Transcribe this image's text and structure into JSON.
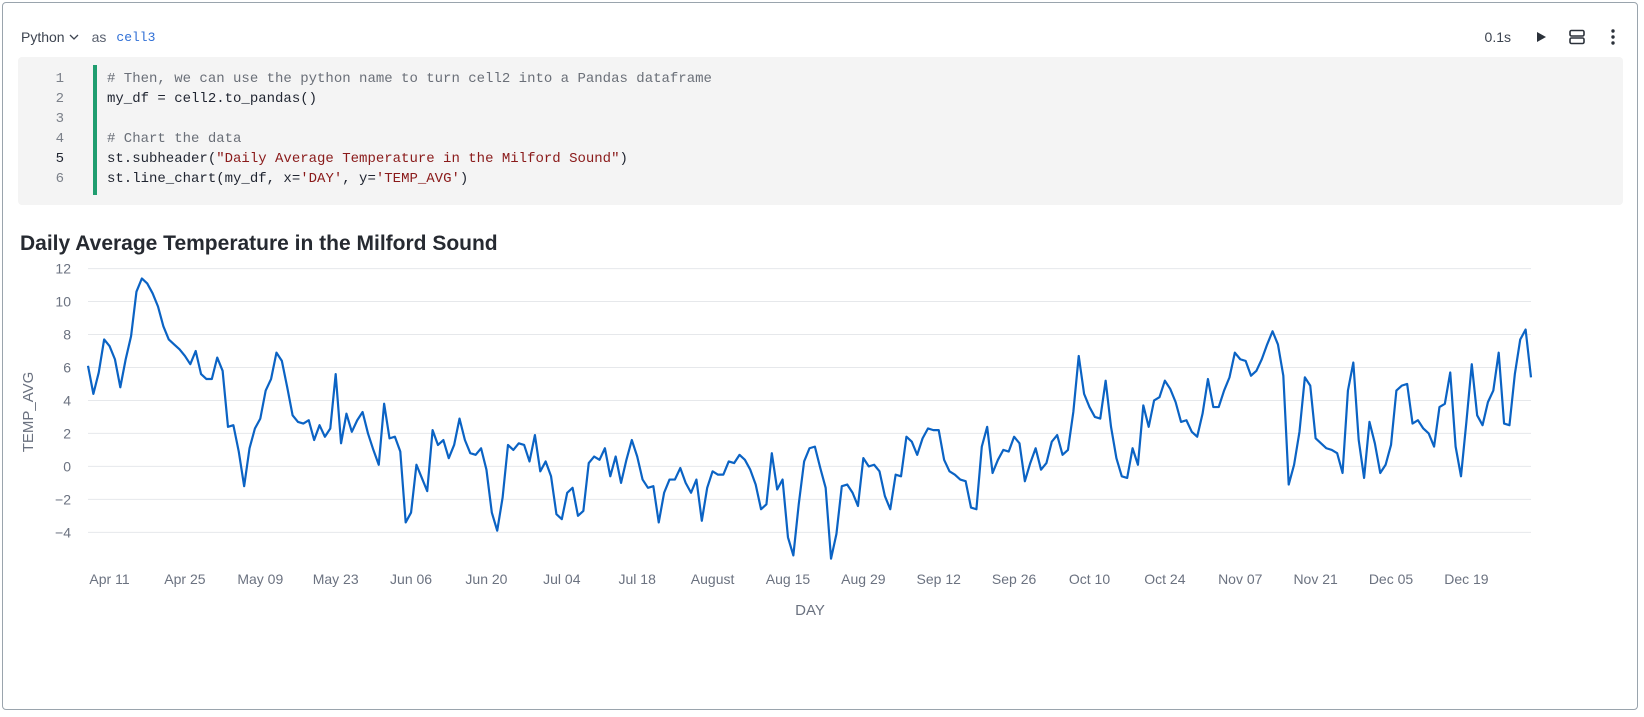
{
  "cell": {
    "language": "Python",
    "as_label": "as",
    "name": "cell3",
    "run_time": "0.1s"
  },
  "editor": {
    "line_numbers": [
      "1",
      "2",
      "3",
      "4",
      "5",
      "6"
    ],
    "lines": {
      "l1": "# Then, we can use the python name to turn cell2 into a Pandas dataframe",
      "l2": "my_df = cell2.to_pandas()",
      "l3": "",
      "l4": "# Chart the data",
      "l5a": "st.subheader(",
      "l5b": "\"Daily Average Temperature in the Milford Sound\"",
      "l5c": ")",
      "l6a": "st.line_chart(my_df, x=",
      "l6b": "'DAY'",
      "l6c": ", y=",
      "l6d": "'TEMP_AVG'",
      "l6e": ")"
    }
  },
  "output": {
    "subheader": "Daily Average Temperature in the Milford Sound"
  },
  "chart_data": {
    "type": "line",
    "title": "",
    "xlabel": "DAY",
    "ylabel": "TEMP_AVG",
    "ylim": [
      -5.8,
      12.4
    ],
    "yticks": [
      -4,
      -2,
      0,
      2,
      4,
      6,
      8,
      10,
      12
    ],
    "x_start": "2023-04-07",
    "xtick_labels": [
      "Apr 11",
      "Apr 25",
      "May 09",
      "May 23",
      "Jun 06",
      "Jun 20",
      "Jul 04",
      "Jul 18",
      "August",
      "Aug 15",
      "Aug 29",
      "Sep 12",
      "Sep 26",
      "Oct 10",
      "Oct 24",
      "Nov 07",
      "Nov 21",
      "Dec 05",
      "Dec 19"
    ],
    "xtick_days": [
      4,
      18,
      32,
      46,
      60,
      74,
      88,
      102,
      116,
      130,
      144,
      158,
      172,
      186,
      200,
      214,
      228,
      242,
      256
    ],
    "grid": true,
    "color": "#0b63c4",
    "series": [
      {
        "values": [
          6.1,
          4.4,
          5.7,
          7.7,
          7.3,
          6.5,
          4.8,
          6.5,
          7.9,
          10.6,
          11.4,
          11.1,
          10.5,
          9.7,
          8.5,
          7.7,
          7.4,
          7.1,
          6.7,
          6.2,
          7.0,
          5.6,
          5.3,
          5.3,
          6.6,
          5.8,
          2.4,
          2.5,
          0.9,
          -1.2,
          1.1,
          2.3,
          2.9,
          4.6,
          5.3,
          6.9,
          6.4,
          4.8,
          3.1,
          2.7,
          2.6,
          2.8,
          1.6,
          2.5,
          1.8,
          2.3,
          5.6,
          1.4,
          3.2,
          2.1,
          2.8,
          3.3,
          2.0,
          1.0,
          0.1,
          3.8,
          1.7,
          1.8,
          0.9,
          -3.4,
          -2.8,
          0.1,
          -0.7,
          -1.5,
          2.2,
          1.3,
          1.6,
          0.5,
          1.3,
          2.9,
          1.6,
          0.8,
          0.7,
          1.1,
          -0.2,
          -2.8,
          -3.9,
          -1.9,
          1.3,
          1.0,
          1.4,
          1.3,
          0.3,
          1.9,
          -0.3,
          0.3,
          -0.6,
          -2.9,
          -3.2,
          -1.6,
          -1.3,
          -3.0,
          -2.7,
          0.2,
          0.6,
          0.4,
          1.1,
          -0.6,
          0.6,
          -1.0,
          0.4,
          1.6,
          0.6,
          -0.8,
          -1.3,
          -1.2,
          -3.4,
          -1.6,
          -0.8,
          -0.8,
          -0.1,
          -1.0,
          -1.6,
          -0.8,
          -3.3,
          -1.3,
          -0.3,
          -0.5,
          -0.5,
          0.3,
          0.2,
          0.7,
          0.4,
          -0.2,
          -1.1,
          -2.6,
          -2.3,
          0.8,
          -1.4,
          -0.8,
          -4.3,
          -5.4,
          -2.3,
          0.3,
          1.1,
          1.2,
          -0.1,
          -1.3,
          -5.6,
          -4.1,
          -1.2,
          -1.1,
          -1.6,
          -2.4,
          0.5,
          0.0,
          0.1,
          -0.3,
          -1.8,
          -2.6,
          -0.5,
          -0.6,
          1.8,
          1.5,
          0.7,
          1.7,
          2.3,
          2.2,
          2.2,
          0.4,
          -0.3,
          -0.5,
          -0.8,
          -0.9,
          -2.5,
          -2.6,
          1.2,
          2.4,
          -0.4,
          0.4,
          1.0,
          0.9,
          1.8,
          1.4,
          -0.9,
          0.2,
          1.1,
          -0.2,
          0.2,
          1.5,
          1.9,
          0.7,
          1.0,
          3.3,
          6.7,
          4.4,
          3.6,
          3.0,
          2.9,
          5.2,
          2.4,
          0.5,
          -0.6,
          -0.7,
          1.1,
          0.1,
          3.7,
          2.4,
          4.0,
          4.2,
          5.2,
          4.7,
          3.9,
          2.7,
          2.8,
          2.1,
          1.8,
          3.2,
          5.3,
          3.6,
          3.6,
          4.6,
          5.4,
          6.9,
          6.5,
          6.4,
          5.5,
          5.8,
          6.5,
          7.4,
          8.2,
          7.4,
          5.5,
          -1.1,
          0.1,
          2.1,
          5.4,
          4.9,
          1.7,
          1.4,
          1.1,
          1.0,
          0.8,
          -0.4,
          4.6,
          6.3,
          1.6,
          -0.7,
          2.7,
          1.4,
          -0.4,
          0.1,
          1.3,
          4.6,
          4.9,
          5.0,
          2.6,
          2.8,
          2.3,
          2.0,
          1.2,
          3.6,
          3.8,
          5.7,
          1.2,
          -0.6,
          2.7,
          6.2,
          3.1,
          2.5,
          3.9,
          4.6,
          6.9,
          2.6,
          2.5,
          5.6,
          7.7,
          8.3,
          5.4
        ]
      }
    ]
  }
}
